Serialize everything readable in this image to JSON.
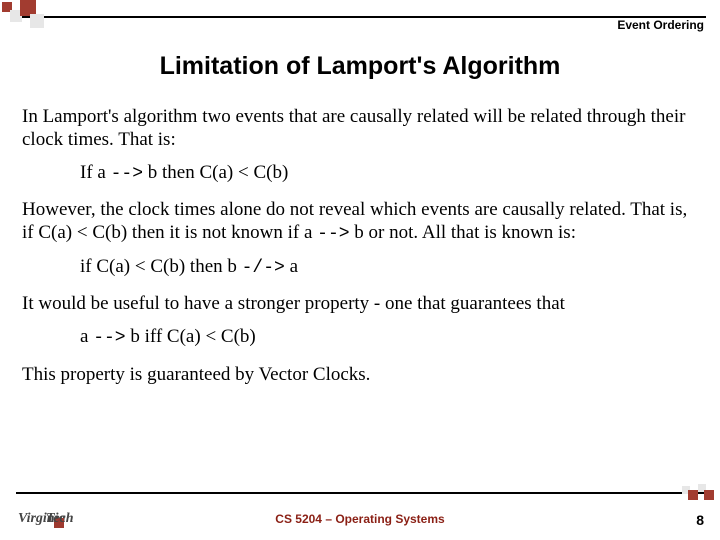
{
  "header": {
    "label": "Event Ordering"
  },
  "title": "Limitation of Lamport's Algorithm",
  "body": {
    "p1": "In Lamport's algorithm two events that are causally related will be related through their clock times. That is:",
    "l1_pre": "If a ",
    "l1_sym": "-->",
    "l1_post": " b then C(a) < C(b)",
    "p2a": "However, the clock times alone do not reveal which events are causally related. That is, if C(a) < C(b) then it is not known if a ",
    "p2_sym": "-->",
    "p2b": " b or not. All that is known is:",
    "l2_pre": "if C(a) < C(b) then b ",
    "l2_sym": "-/->",
    "l2_post": " a",
    "p3": "It would be useful to have a stronger property - one that guarantees that",
    "l3_pre": "a ",
    "l3_sym": "-->",
    "l3_post": "  b iff C(a) < C(b)",
    "p4": "This property is guaranteed by Vector Clocks."
  },
  "footer": {
    "logo_text1": "Virginia",
    "logo_text2": "Tech",
    "course": "CS 5204 – Operating Systems",
    "page": "8"
  }
}
